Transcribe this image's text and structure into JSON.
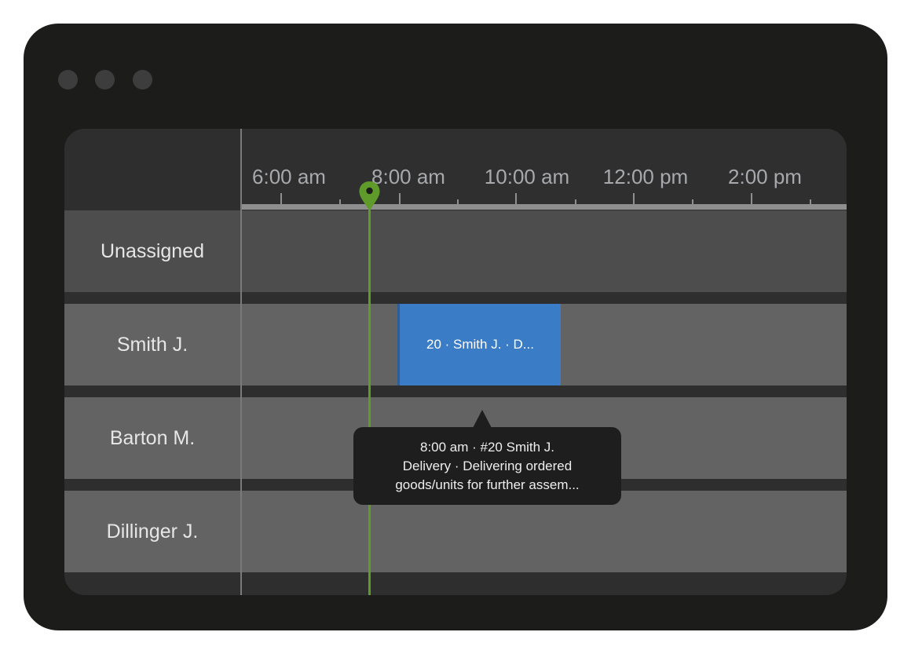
{
  "window": {
    "controls": [
      "window-dot",
      "window-dot",
      "window-dot"
    ]
  },
  "timeline": {
    "time_labels": [
      "6:00 am",
      "8:00 am",
      "10:00 am",
      "12:00 pm",
      "2:00 pm"
    ],
    "current_time_marker": "location-pin-icon"
  },
  "resources": [
    {
      "label": "Unassigned"
    },
    {
      "label": "Smith J."
    },
    {
      "label": "Barton M."
    },
    {
      "label": "Dillinger J."
    }
  ],
  "event": {
    "label": "20 · Smith J. · D...",
    "color": "#3a7cc6"
  },
  "tooltip": {
    "line1": "8:00 am · #20 Smith J.",
    "line2": "Delivery · Delivering ordered",
    "line3": "goods/units for further assem..."
  },
  "colors": {
    "now_line": "#5f9b2a",
    "background": "#1c1c1b"
  }
}
